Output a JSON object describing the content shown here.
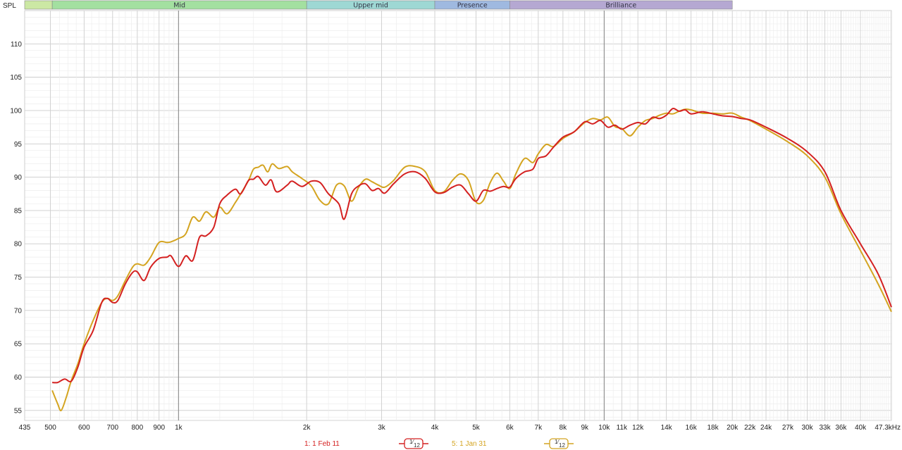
{
  "chart_data": {
    "type": "line",
    "xscale": "log",
    "xlim": [
      435,
      47300
    ],
    "ylim": [
      53.5,
      115
    ],
    "ylabel_corner": "SPL",
    "bands": [
      {
        "name": "",
        "from": 435,
        "to": 505,
        "color": "#cce8a4"
      },
      {
        "name": "Mid",
        "from": 505,
        "to": 2000,
        "color": "#a3e0a0"
      },
      {
        "name": "Upper mid",
        "from": 2000,
        "to": 4000,
        "color": "#9ed8d4"
      },
      {
        "name": "Presence",
        "from": 4000,
        "to": 6000,
        "color": "#9fb9e0"
      },
      {
        "name": "Brilliance",
        "from": 6000,
        "to": 20000,
        "color": "#b5a8d2"
      }
    ],
    "yticks": [
      55,
      60,
      65,
      70,
      75,
      80,
      85,
      90,
      95,
      100,
      105,
      110
    ],
    "xticks": [
      {
        "v": 435,
        "t": "435"
      },
      {
        "v": 500,
        "t": "500"
      },
      {
        "v": 600,
        "t": "600"
      },
      {
        "v": 700,
        "t": "700"
      },
      {
        "v": 800,
        "t": "800"
      },
      {
        "v": 900,
        "t": "900"
      },
      {
        "v": 1000,
        "t": "1k"
      },
      {
        "v": 2000,
        "t": "2k"
      },
      {
        "v": 3000,
        "t": "3k"
      },
      {
        "v": 4000,
        "t": "4k"
      },
      {
        "v": 5000,
        "t": "5k"
      },
      {
        "v": 6000,
        "t": "6k"
      },
      {
        "v": 7000,
        "t": "7k"
      },
      {
        "v": 8000,
        "t": "8k"
      },
      {
        "v": 9000,
        "t": "9k"
      },
      {
        "v": 10000,
        "t": "10k"
      },
      {
        "v": 11000,
        "t": "11k"
      },
      {
        "v": 12000,
        "t": "12k"
      },
      {
        "v": 14000,
        "t": "14k"
      },
      {
        "v": 16000,
        "t": "16k"
      },
      {
        "v": 18000,
        "t": "18k"
      },
      {
        "v": 20000,
        "t": "20k"
      },
      {
        "v": 22000,
        "t": "22k"
      },
      {
        "v": 24000,
        "t": "24k"
      },
      {
        "v": 27000,
        "t": "27k"
      },
      {
        "v": 30000,
        "t": "30k"
      },
      {
        "v": 33000,
        "t": "33k"
      },
      {
        "v": 36000,
        "t": "36k"
      },
      {
        "v": 40000,
        "t": "40k"
      },
      {
        "v": 47300,
        "t": "47.3kHz"
      }
    ],
    "series": [
      {
        "name": "1: 1 Feb 11",
        "color": "#d42020",
        "smoothing": "1/12",
        "points": [
          [
            505,
            59.2
          ],
          [
            520,
            59.2
          ],
          [
            540,
            59.7
          ],
          [
            560,
            59.4
          ],
          [
            580,
            61.5
          ],
          [
            600,
            64.5
          ],
          [
            630,
            67
          ],
          [
            660,
            71.2
          ],
          [
            680,
            71.8
          ],
          [
            700,
            71.2
          ],
          [
            720,
            71.5
          ],
          [
            750,
            74
          ],
          [
            780,
            75.7
          ],
          [
            800,
            75.8
          ],
          [
            830,
            74.5
          ],
          [
            860,
            76.5
          ],
          [
            900,
            77.8
          ],
          [
            940,
            78
          ],
          [
            960,
            78.2
          ],
          [
            1000,
            76.6
          ],
          [
            1040,
            78.2
          ],
          [
            1080,
            77.5
          ],
          [
            1120,
            81
          ],
          [
            1160,
            81.2
          ],
          [
            1210,
            82.5
          ],
          [
            1250,
            86
          ],
          [
            1300,
            87.3
          ],
          [
            1360,
            88.2
          ],
          [
            1400,
            87.5
          ],
          [
            1460,
            89.5
          ],
          [
            1500,
            89.7
          ],
          [
            1540,
            90.1
          ],
          [
            1600,
            88.8
          ],
          [
            1650,
            89.6
          ],
          [
            1700,
            87.8
          ],
          [
            1800,
            88.8
          ],
          [
            1850,
            89.4
          ],
          [
            1950,
            88.6
          ],
          [
            2050,
            89.4
          ],
          [
            2150,
            89.2
          ],
          [
            2250,
            87.5
          ],
          [
            2380,
            86
          ],
          [
            2450,
            83.7
          ],
          [
            2550,
            87.5
          ],
          [
            2650,
            88.7
          ],
          [
            2750,
            89
          ],
          [
            2850,
            88
          ],
          [
            2950,
            88.3
          ],
          [
            3050,
            87.6
          ],
          [
            3200,
            89
          ],
          [
            3400,
            90.5
          ],
          [
            3600,
            90.8
          ],
          [
            3800,
            89.8
          ],
          [
            4000,
            87.8
          ],
          [
            4200,
            87.7
          ],
          [
            4400,
            88.5
          ],
          [
            4600,
            88.8
          ],
          [
            4800,
            87.5
          ],
          [
            5000,
            86.4
          ],
          [
            5200,
            88
          ],
          [
            5400,
            87.9
          ],
          [
            5600,
            88.3
          ],
          [
            5800,
            88.6
          ],
          [
            6000,
            88.5
          ],
          [
            6200,
            89.8
          ],
          [
            6500,
            90.8
          ],
          [
            6800,
            91.2
          ],
          [
            7000,
            92.8
          ],
          [
            7300,
            93.2
          ],
          [
            7600,
            94.5
          ],
          [
            8000,
            96
          ],
          [
            8500,
            96.8
          ],
          [
            9000,
            98.3
          ],
          [
            9400,
            98
          ],
          [
            9800,
            98.5
          ],
          [
            10200,
            97.5
          ],
          [
            10600,
            97.8
          ],
          [
            11000,
            97.2
          ],
          [
            11500,
            97.8
          ],
          [
            12000,
            98.2
          ],
          [
            12500,
            98
          ],
          [
            13000,
            99
          ],
          [
            13500,
            98.8
          ],
          [
            14000,
            99.3
          ],
          [
            14500,
            100.3
          ],
          [
            15000,
            99.9
          ],
          [
            15500,
            100.1
          ],
          [
            16000,
            99.5
          ],
          [
            17000,
            99.8
          ],
          [
            18000,
            99.5
          ],
          [
            19000,
            99.2
          ],
          [
            20000,
            99.1
          ],
          [
            21000,
            98.8
          ],
          [
            22000,
            98.6
          ],
          [
            24000,
            97.5
          ],
          [
            27000,
            95.8
          ],
          [
            30000,
            93.8
          ],
          [
            33000,
            90.8
          ],
          [
            36000,
            85
          ],
          [
            40000,
            80
          ],
          [
            44000,
            75.5
          ],
          [
            47300,
            70.5
          ]
        ]
      },
      {
        "name": "5: 1 Jan 31",
        "color": "#d4a420",
        "smoothing": "1/12",
        "points": [
          [
            505,
            58
          ],
          [
            520,
            56
          ],
          [
            530,
            55
          ],
          [
            545,
            57
          ],
          [
            560,
            59.5
          ],
          [
            580,
            62
          ],
          [
            600,
            65
          ],
          [
            630,
            68.5
          ],
          [
            660,
            71.2
          ],
          [
            680,
            71.8
          ],
          [
            700,
            71.5
          ],
          [
            720,
            72.2
          ],
          [
            750,
            74.5
          ],
          [
            780,
            76.5
          ],
          [
            800,
            77
          ],
          [
            830,
            76.8
          ],
          [
            860,
            78
          ],
          [
            900,
            80.2
          ],
          [
            940,
            80.2
          ],
          [
            960,
            80.3
          ],
          [
            1000,
            80.8
          ],
          [
            1040,
            81.5
          ],
          [
            1080,
            84
          ],
          [
            1120,
            83.4
          ],
          [
            1160,
            84.8
          ],
          [
            1210,
            84
          ],
          [
            1250,
            85.5
          ],
          [
            1300,
            84.5
          ],
          [
            1360,
            86.2
          ],
          [
            1400,
            87.5
          ],
          [
            1460,
            89.5
          ],
          [
            1500,
            91.2
          ],
          [
            1540,
            91.5
          ],
          [
            1580,
            91.8
          ],
          [
            1620,
            90.8
          ],
          [
            1660,
            92
          ],
          [
            1720,
            91.3
          ],
          [
            1800,
            91.6
          ],
          [
            1850,
            90.8
          ],
          [
            1950,
            89.8
          ],
          [
            2050,
            88.7
          ],
          [
            2150,
            86.5
          ],
          [
            2250,
            86
          ],
          [
            2350,
            88.8
          ],
          [
            2450,
            88.7
          ],
          [
            2550,
            86.4
          ],
          [
            2650,
            88.5
          ],
          [
            2750,
            89.7
          ],
          [
            2850,
            89.3
          ],
          [
            2950,
            88.8
          ],
          [
            3050,
            88.5
          ],
          [
            3200,
            89.5
          ],
          [
            3400,
            91.5
          ],
          [
            3600,
            91.6
          ],
          [
            3800,
            90.8
          ],
          [
            4000,
            88
          ],
          [
            4200,
            87.8
          ],
          [
            4400,
            89.5
          ],
          [
            4600,
            90.5
          ],
          [
            4800,
            89.5
          ],
          [
            5000,
            86.3
          ],
          [
            5200,
            86.5
          ],
          [
            5400,
            89.2
          ],
          [
            5600,
            90.6
          ],
          [
            5800,
            89.4
          ],
          [
            6000,
            88.3
          ],
          [
            6200,
            90.5
          ],
          [
            6500,
            92.8
          ],
          [
            6800,
            92.2
          ],
          [
            7000,
            93.5
          ],
          [
            7300,
            94.9
          ],
          [
            7600,
            94.6
          ],
          [
            8000,
            95.8
          ],
          [
            8500,
            96.8
          ],
          [
            9000,
            98.2
          ],
          [
            9400,
            98.8
          ],
          [
            9800,
            98.6
          ],
          [
            10200,
            99
          ],
          [
            10600,
            97.6
          ],
          [
            11000,
            97.3
          ],
          [
            11500,
            96.2
          ],
          [
            12000,
            97.5
          ],
          [
            12500,
            98.5
          ],
          [
            13000,
            98.8
          ],
          [
            13500,
            99.3
          ],
          [
            14000,
            99.6
          ],
          [
            14500,
            99.5
          ],
          [
            15000,
            99.9
          ],
          [
            15500,
            100.2
          ],
          [
            16000,
            100.1
          ],
          [
            17000,
            99.6
          ],
          [
            18000,
            99.6
          ],
          [
            19000,
            99.5
          ],
          [
            20000,
            99.6
          ],
          [
            21000,
            99
          ],
          [
            22000,
            98.5
          ],
          [
            24000,
            97.2
          ],
          [
            27000,
            95.3
          ],
          [
            30000,
            93.2
          ],
          [
            33000,
            90
          ],
          [
            36000,
            84.5
          ],
          [
            40000,
            79
          ],
          [
            44000,
            74
          ],
          [
            47300,
            69.8
          ]
        ]
      }
    ]
  },
  "legend": [
    {
      "label": "1: 1 Feb 11",
      "badge": "1/12",
      "color": "#d42020"
    },
    {
      "label": "5: 1 Jan 31",
      "badge": "1/12",
      "color": "#d4a420"
    }
  ]
}
